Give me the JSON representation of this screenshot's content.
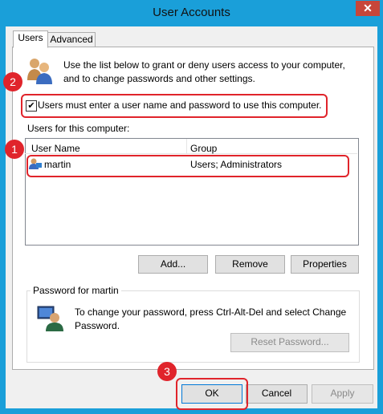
{
  "window": {
    "title": "User Accounts",
    "close_glyph": "✕"
  },
  "tabs": [
    {
      "label": "Users",
      "active": true
    },
    {
      "label": "Advanced",
      "active": false
    }
  ],
  "intro_text": "Use the list below to grant or deny users access to your computer, and to change passwords and other settings.",
  "require_login": {
    "checked": true,
    "label": "Users must enter a user name and password to use this computer."
  },
  "users_section": {
    "label": "Users for this computer:",
    "columns": [
      "User Name",
      "Group"
    ],
    "rows": [
      {
        "name": "martin",
        "group": "Users; Administrators"
      }
    ]
  },
  "user_buttons": {
    "add": "Add...",
    "remove": "Remove",
    "properties": "Properties"
  },
  "password_group": {
    "title": "Password for martin",
    "text": "To change your password, press Ctrl-Alt-Del and select Change Password.",
    "reset_button": "Reset Password..."
  },
  "dialog_buttons": {
    "ok": "OK",
    "cancel": "Cancel",
    "apply": "Apply"
  },
  "annotations": {
    "badge_1": "1",
    "badge_2": "2",
    "badge_3": "3"
  },
  "colors": {
    "accent": "#1a9fd9",
    "annotation": "#e0242b"
  }
}
